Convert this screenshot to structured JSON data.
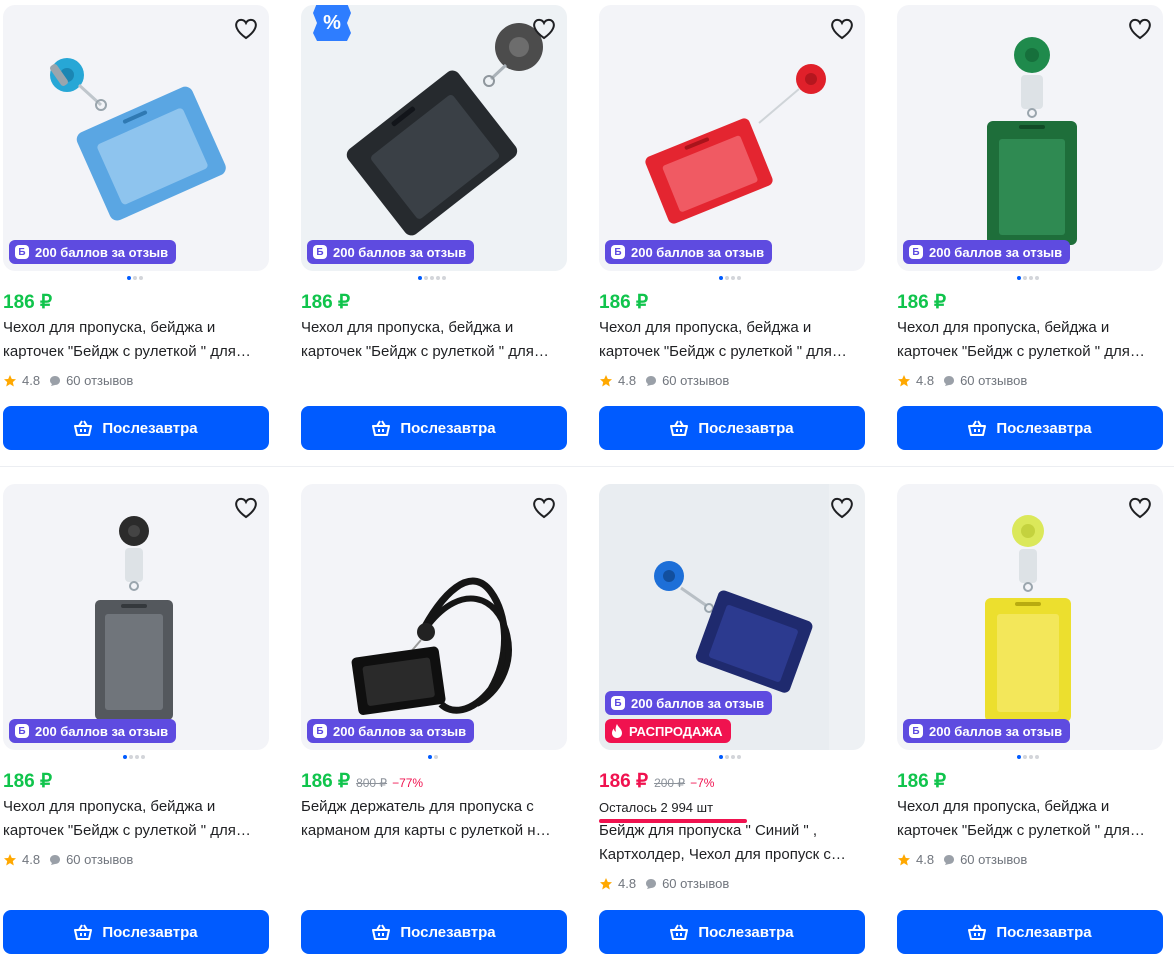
{
  "colors": {
    "accent": "#005bff",
    "price": "#10c44c",
    "sale": "#f0124f",
    "bonus": "#5e4be0",
    "star": "#ffa800"
  },
  "cards": [
    {
      "price": "186 ₽",
      "title1": "Чехол для пропуска, бейджа и",
      "title2": "карточек \"Бейдж с рулеткой \" для…",
      "badge": "200 баллов за отзыв",
      "rating": "4.8",
      "reviews": "60 отзывов",
      "button": "Послезавтра",
      "image": "blue-badge-holder"
    },
    {
      "price": "186 ₽",
      "title1": "Чехол для пропуска, бейджа и",
      "title2": "карточек \"Бейдж с рулеткой \" для…",
      "badge": "200 баллов за отзыв",
      "button": "Послезавтра",
      "image": "black-badge-holder"
    },
    {
      "price": "186 ₽",
      "title1": "Чехол для пропуска, бейджа и",
      "title2": "карточек \"Бейдж с рулеткой \" для…",
      "badge": "200 баллов за отзыв",
      "rating": "4.8",
      "reviews": "60 отзывов",
      "button": "Послезавтра",
      "image": "red-badge-holder"
    },
    {
      "price": "186 ₽",
      "title1": "Чехол для пропуска, бейджа и",
      "title2": "карточек \"Бейдж с рулеткой \" для…",
      "badge": "200 баллов за отзыв",
      "rating": "4.8",
      "reviews": "60 отзывов",
      "button": "Послезавтра",
      "image": "green-badge-holder"
    },
    {
      "price": "186 ₽",
      "title1": "Чехол для пропуска, бейджа и",
      "title2": "карточек \"Бейдж с рулеткой \" для…",
      "badge": "200 баллов за отзыв",
      "rating": "4.8",
      "reviews": "60 отзывов",
      "button": "Послезавтра",
      "image": "gray-badge-holder"
    },
    {
      "price": "186 ₽",
      "old_price": "800 ₽",
      "discount": "−77%",
      "title1": "Бейдж держатель для пропуска с",
      "title2": "карманом для карты с рулеткой н…",
      "badge": "200 баллов за отзыв",
      "button": "Послезавтра",
      "image": "black-lanyard-holder"
    },
    {
      "price": "186 ₽",
      "old_price": "200 ₽",
      "discount": "−7%",
      "stock": "Осталось 2 994 шт",
      "title1": "Бейдж для пропуска \" Синий \" ,",
      "title2": "Картхолдер, Чехол для пропуск с…",
      "badge": "200 баллов за отзыв",
      "sale": "РАСПРОДАЖА",
      "rating": "4.8",
      "reviews": "60 отзывов",
      "button": "Послезавтра",
      "image": "navy-badge-holder"
    },
    {
      "price": "186 ₽",
      "title1": "Чехол для пропуска, бейджа и",
      "title2": "карточек \"Бейдж с рулеткой \" для…",
      "badge": "200 баллов за отзыв",
      "rating": "4.8",
      "reviews": "60 отзывов",
      "button": "Послезавтра",
      "image": "yellow-badge-holder"
    }
  ],
  "icons": {
    "favorite": "heart-icon",
    "cart": "basket-icon",
    "star": "star-icon",
    "reviews": "chat-bubble-icon",
    "promo": "percent-icon",
    "sale": "fire-icon",
    "bonus": "bonus-b-icon"
  }
}
